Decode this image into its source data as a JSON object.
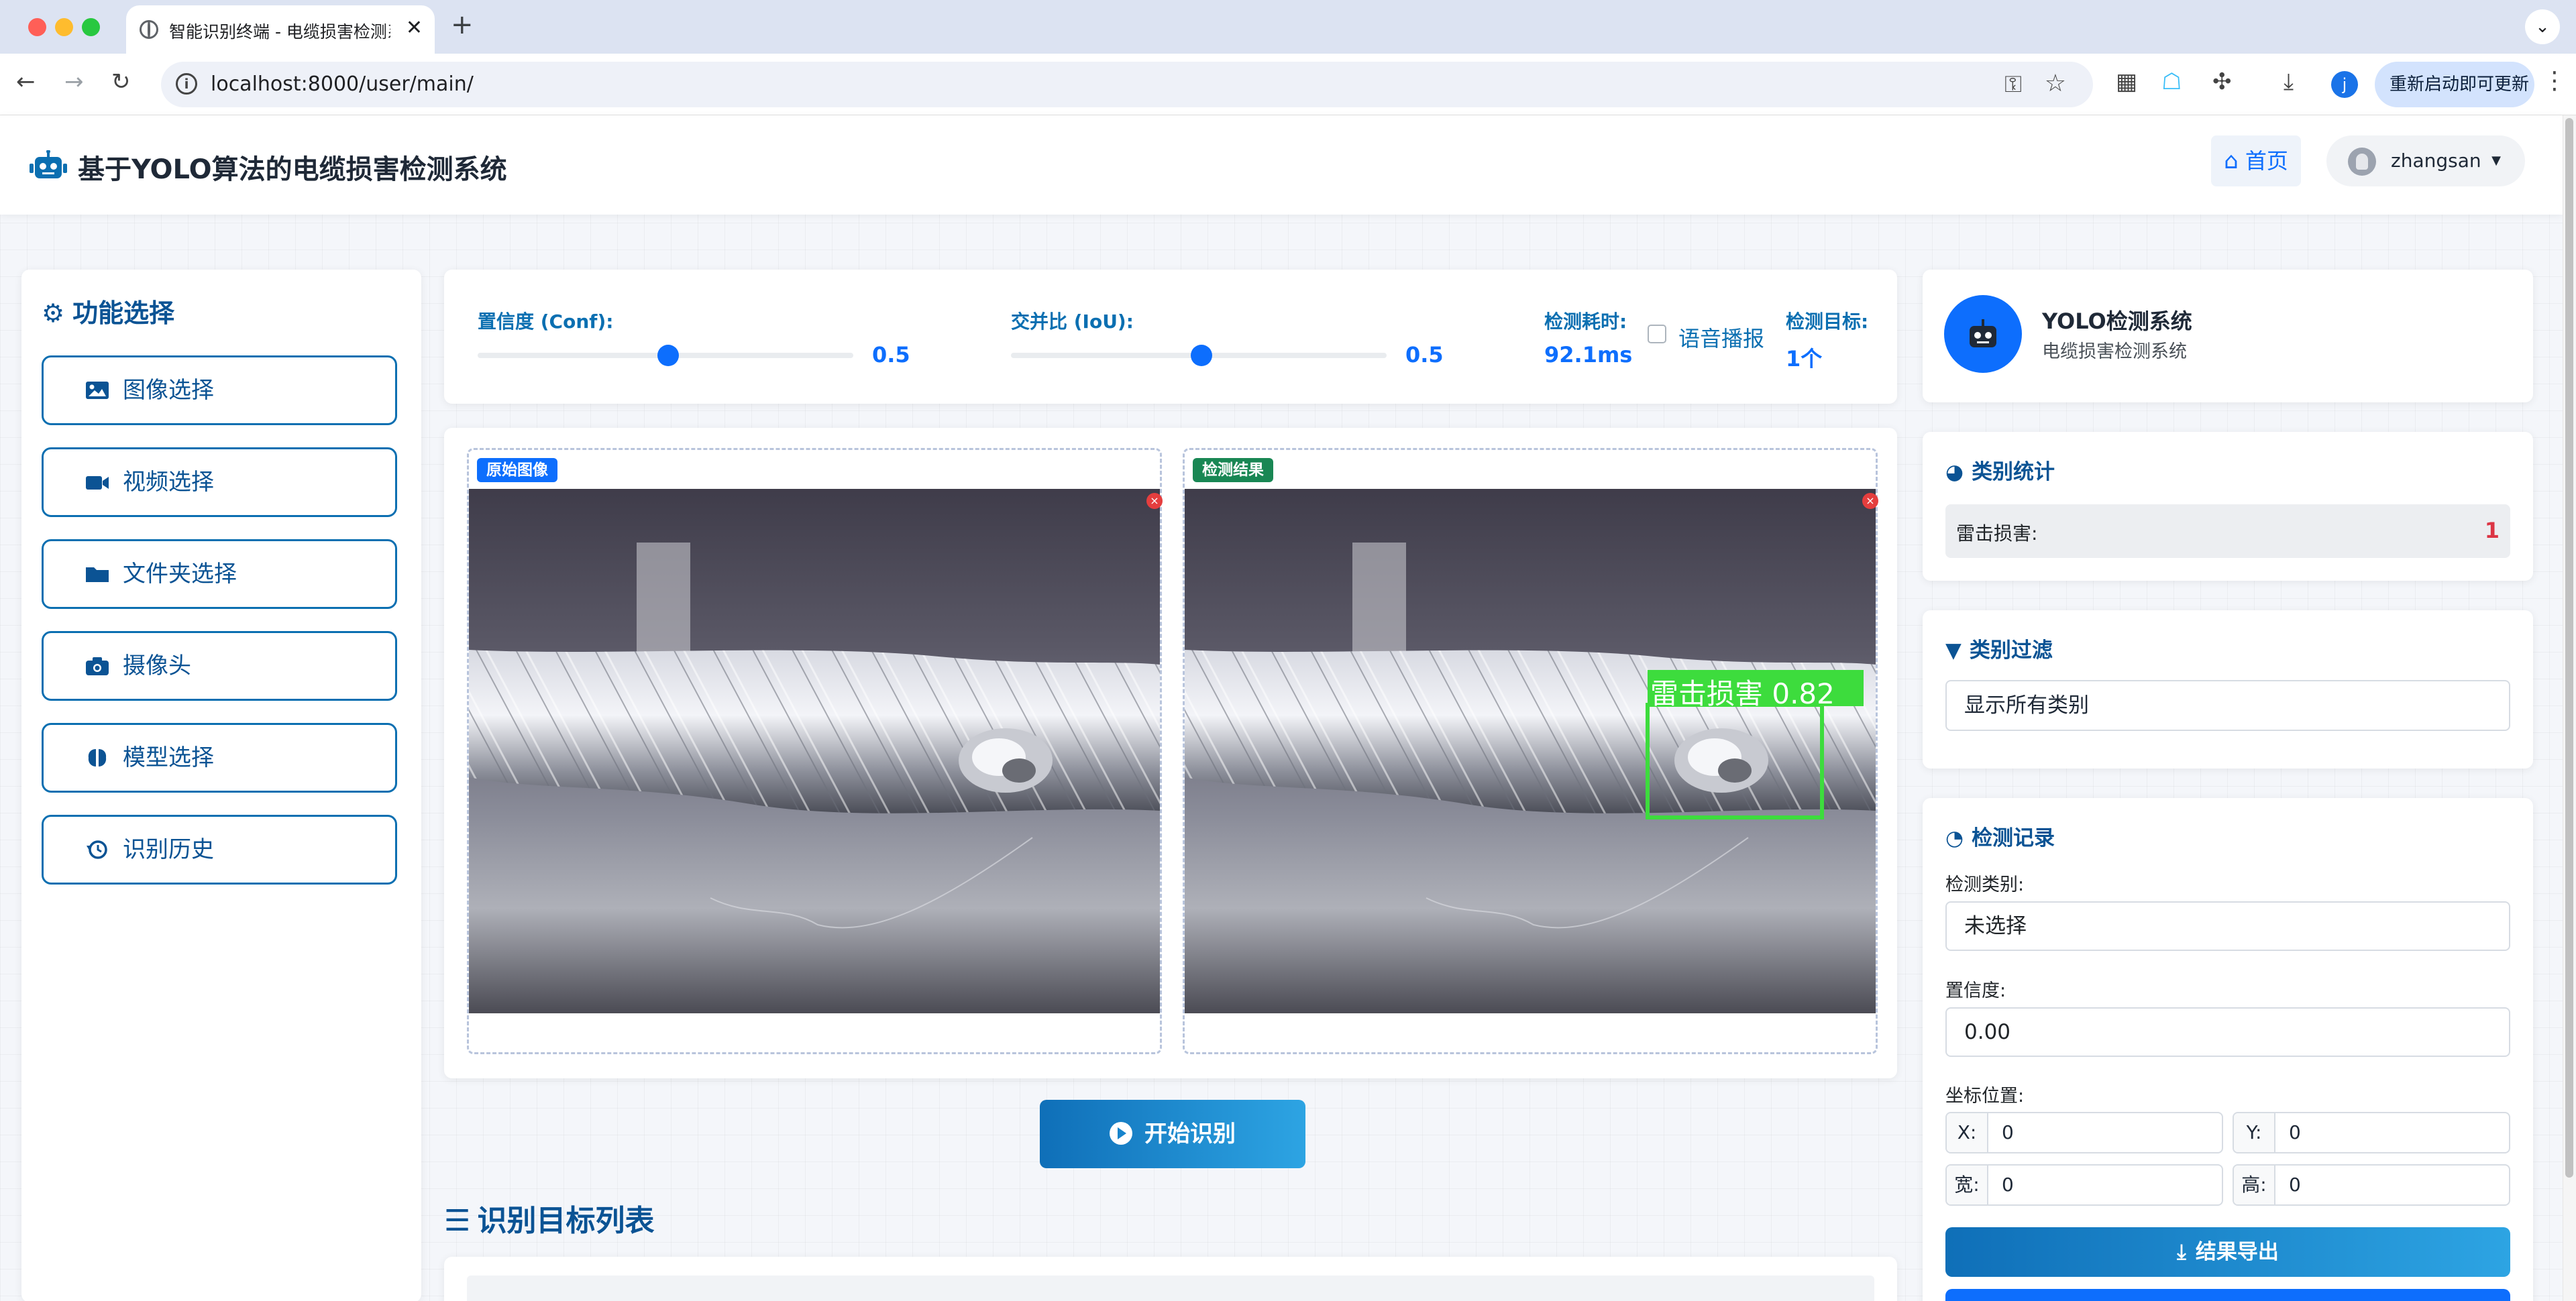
{
  "browser": {
    "tab_title": "智能识别终端 - 电缆损害检测系",
    "url": "localhost:8000/user/main/",
    "relaunch_label": "重新启动即可更新",
    "profile_initial": "j"
  },
  "header": {
    "title": "基于YOLO算法的电缆损害检测系统",
    "home_label": "首页",
    "username": "zhangsan"
  },
  "menu": {
    "title": "功能选择",
    "items": [
      {
        "label": "图像选择",
        "icon": "image-icon"
      },
      {
        "label": "视频选择",
        "icon": "video-icon"
      },
      {
        "label": "文件夹选择",
        "icon": "folder-icon"
      },
      {
        "label": "摄像头",
        "icon": "camera-icon"
      },
      {
        "label": "模型选择",
        "icon": "brain-icon"
      },
      {
        "label": "识别历史",
        "icon": "history-icon"
      }
    ]
  },
  "controls": {
    "conf_label": "置信度 (Conf):",
    "conf_value": "0.5",
    "iou_label": "交并比 (IoU):",
    "iou_value": "0.5",
    "time_label": "检测耗时:",
    "time_value": "92.1ms",
    "voice_label": "语音播报",
    "target_label": "检测目标:",
    "target_value": "1个"
  },
  "images": {
    "original_label": "原始图像",
    "result_label": "检测结果",
    "detection_label": "雷击损害 0.82"
  },
  "start_button": "开始识别",
  "list_title": "识别目标列表",
  "info": {
    "title": "YOLO检测系统",
    "subtitle": "电缆损害检测系统"
  },
  "stats": {
    "title": "类别统计",
    "rows": [
      {
        "name": "雷击损害:",
        "count": "1"
      }
    ]
  },
  "filter": {
    "title": "类别过滤",
    "selected": "显示所有类别"
  },
  "record": {
    "title": "检测记录",
    "class_label": "检测类别:",
    "class_value": "未选择",
    "conf_label": "置信度:",
    "conf_value": "0.00",
    "coord_label": "坐标位置:",
    "x_label": "X:",
    "x_value": "0",
    "y_label": "Y:",
    "y_value": "0",
    "w_label": "宽:",
    "w_value": "0",
    "h_label": "高:",
    "h_value": "0",
    "export_label": "结果导出"
  },
  "colors": {
    "primary": "#0d6efd",
    "brand_dark": "#0b5394",
    "detect_box": "#3ddc3d",
    "danger": "#dc3545"
  }
}
